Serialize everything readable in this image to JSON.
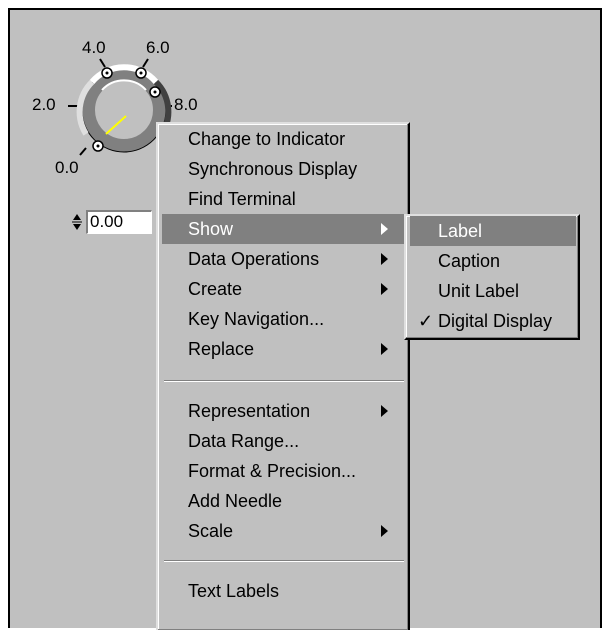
{
  "knob": {
    "scale_labels": [
      "0.0",
      "2.0",
      "4.0",
      "6.0",
      "8.0"
    ],
    "value": "0.00"
  },
  "context_menu": {
    "items": [
      {
        "label": "Change to Indicator",
        "submenu": false
      },
      {
        "label": "Synchronous Display",
        "submenu": false
      },
      {
        "label": "Find Terminal",
        "submenu": false
      },
      {
        "label": "Show",
        "submenu": true,
        "highlighted": true
      },
      {
        "label": "Data Operations",
        "submenu": true
      },
      {
        "label": "Create",
        "submenu": true
      },
      {
        "label": "Key Navigation...",
        "submenu": false
      },
      {
        "label": "Replace",
        "submenu": true
      },
      {
        "label": "Representation",
        "submenu": true
      },
      {
        "label": "Data Range...",
        "submenu": false
      },
      {
        "label": "Format & Precision...",
        "submenu": false
      },
      {
        "label": "Add Needle",
        "submenu": false
      },
      {
        "label": "Scale",
        "submenu": true
      },
      {
        "label": "Text Labels",
        "submenu": false
      }
    ]
  },
  "show_submenu": {
    "items": [
      {
        "label": "Label",
        "highlighted": true,
        "checked": false
      },
      {
        "label": "Caption",
        "checked": false
      },
      {
        "label": "Unit Label",
        "checked": false
      },
      {
        "label": "Digital Display",
        "checked": true
      }
    ],
    "check_glyph": "✓"
  },
  "colors": {
    "panel": "#c0c0c0",
    "highlight": "#808080",
    "needle": "#ffff00"
  }
}
